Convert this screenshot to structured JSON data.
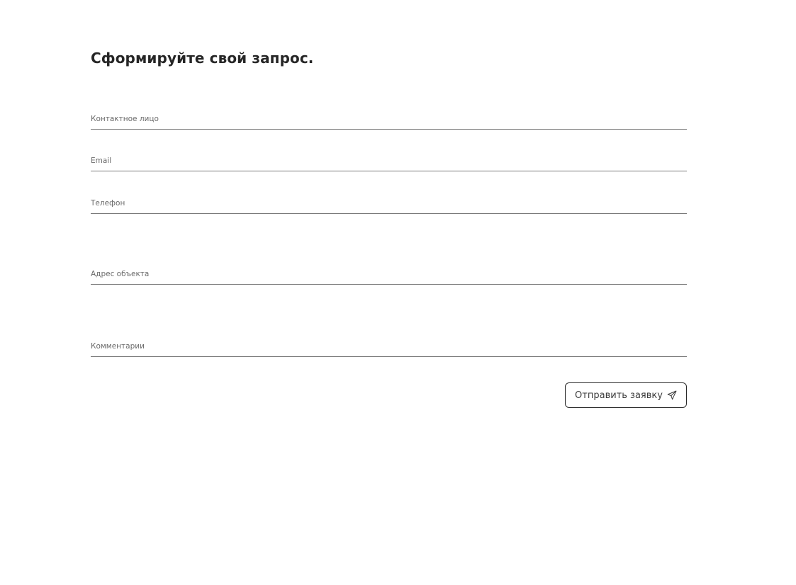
{
  "form": {
    "title": "Сформируйте свой запрос.",
    "fields": [
      {
        "placeholder": "Контактное лицо",
        "value": ""
      },
      {
        "placeholder": "Email",
        "value": ""
      },
      {
        "placeholder": "Телефон",
        "value": ""
      },
      {
        "placeholder": "Адрес объекта",
        "value": ""
      },
      {
        "placeholder": "Комментарии",
        "value": ""
      }
    ],
    "submit": {
      "label": "Отправить заявку",
      "icon": "send-icon"
    }
  },
  "colors": {
    "text": "#262626",
    "placeholder": "#6a6a6a",
    "underline": "#7a7a7a",
    "button_border": "#2a2a2a",
    "background": "#ffffff"
  }
}
